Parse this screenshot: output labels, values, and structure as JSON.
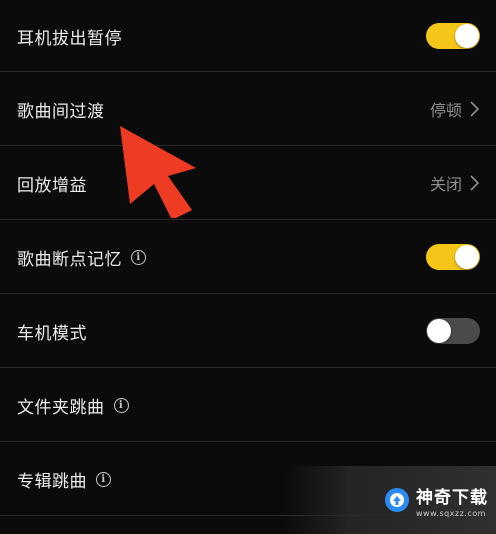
{
  "settings": [
    {
      "label": "耳机拔出暂停",
      "type": "toggle",
      "state": "on"
    },
    {
      "label": "歌曲间过渡",
      "type": "link",
      "value": "停顿"
    },
    {
      "label": "回放增益",
      "type": "link",
      "value": "关闭"
    },
    {
      "label": "歌曲断点记忆",
      "type": "toggle",
      "state": "on",
      "info": true
    },
    {
      "label": "车机模式",
      "type": "toggle",
      "state": "off"
    },
    {
      "label": "文件夹跳曲",
      "type": "info-only",
      "info": true
    },
    {
      "label": "专辑跳曲",
      "type": "info-only",
      "info": true
    }
  ],
  "info_glyph": "i",
  "colors": {
    "background": "#0b0b0b",
    "toggle_on": "#f5c518",
    "toggle_off": "#4a4a4a",
    "annotation_arrow": "#ee3b24"
  },
  "watermark": {
    "brand": "神奇下载",
    "url": "www.sqxzz.com"
  }
}
